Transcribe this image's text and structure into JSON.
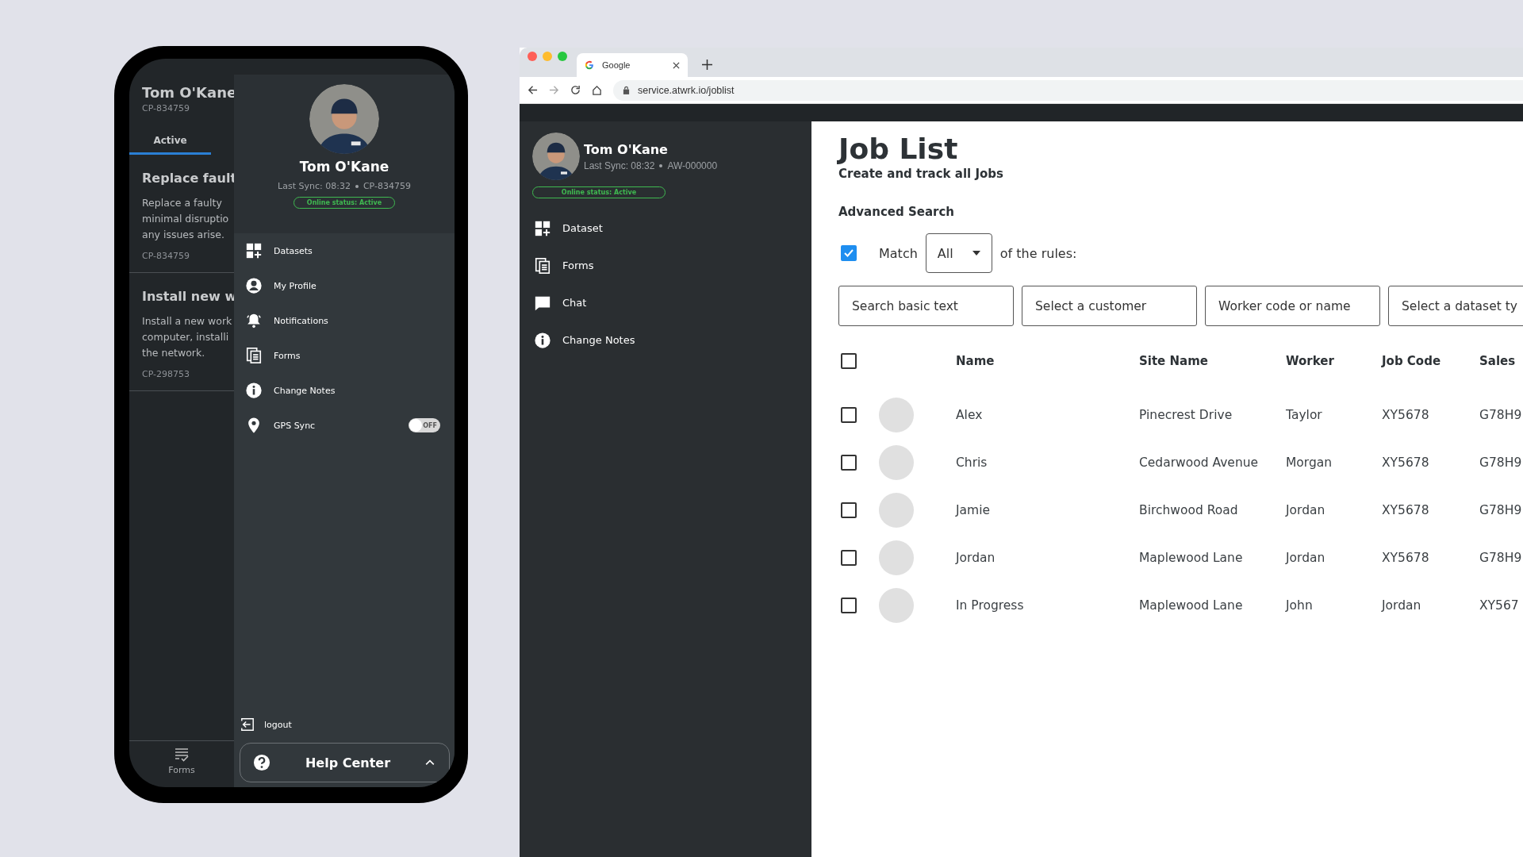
{
  "phone": {
    "header_name": "Tom O'Kane",
    "header_code": "CP-834759",
    "tabs": [
      {
        "label": "Active",
        "selected": true
      }
    ],
    "cards": [
      {
        "title": "Replace fault",
        "description": [
          "Replace a faulty",
          "minimal disruptio",
          "any issues arise."
        ],
        "code": "CP-834759"
      },
      {
        "title": "Install new w",
        "description": [
          "Install a new work",
          "computer, installi",
          "the network."
        ],
        "code": "CP-298753"
      }
    ],
    "bottom_nav": [
      {
        "label": "Forms"
      }
    ],
    "drawer": {
      "name": "Tom O'Kane",
      "last_sync": "Last Sync: 08:32",
      "user_code": "CP-834759",
      "status": "Online status: Active",
      "menu": [
        {
          "label": "Datasets",
          "kind": "link"
        },
        {
          "label": "My Profile",
          "kind": "link"
        },
        {
          "label": "Notifications",
          "kind": "link"
        },
        {
          "label": "Forms",
          "kind": "link"
        },
        {
          "label": "Change Notes",
          "kind": "link"
        },
        {
          "label": "GPS Sync",
          "kind": "toggle",
          "on": false,
          "toggle_text": "OFF"
        }
      ],
      "logout": "logout",
      "help_center": "Help Center"
    }
  },
  "browser": {
    "tab_title": "Google",
    "url": "service.atwrk.io/joblist",
    "sidebar": {
      "name": "Tom O'Kane",
      "last_sync": "Last Sync: 08:32",
      "user_code": "AW-000000",
      "status": "Online status: Active",
      "menu": [
        {
          "label": "Dataset"
        },
        {
          "label": "Forms"
        },
        {
          "label": "Chat"
        },
        {
          "label": "Change Notes"
        }
      ]
    },
    "page": {
      "title": "Job List",
      "subtitle": "Create and track all Jobs",
      "search_title": "Advanced Search",
      "match_checked": true,
      "match_label": "Match",
      "match_value": "All",
      "match_suffix": "of the rules:",
      "fields": [
        {
          "placeholder": "Search basic text"
        },
        {
          "placeholder": "Select a customer"
        },
        {
          "placeholder": "Worker code or name"
        },
        {
          "placeholder": "Select a dataset ty"
        }
      ],
      "all_checked": false,
      "columns": [
        "Name",
        "Site Name",
        "Worker",
        "Job Code",
        "Sales"
      ],
      "rows": [
        {
          "checked": false,
          "cells": [
            "Alex",
            "Pinecrest Drive",
            "Taylor",
            "XY5678",
            "G78H9"
          ]
        },
        {
          "checked": false,
          "cells": [
            "Chris",
            "Cedarwood Avenue",
            "Morgan",
            "XY5678",
            "G78H9"
          ]
        },
        {
          "checked": false,
          "cells": [
            "Jamie",
            "Birchwood Road",
            "Jordan",
            "XY5678",
            "G78H9"
          ]
        },
        {
          "checked": false,
          "cells": [
            "Jordan",
            "Maplewood Lane",
            "Jordan",
            "XY5678",
            "G78H9"
          ]
        },
        {
          "checked": false,
          "cells": [
            "In Progress",
            "Maplewood Lane",
            "John",
            "Jordan",
            "XY567"
          ]
        }
      ]
    }
  }
}
